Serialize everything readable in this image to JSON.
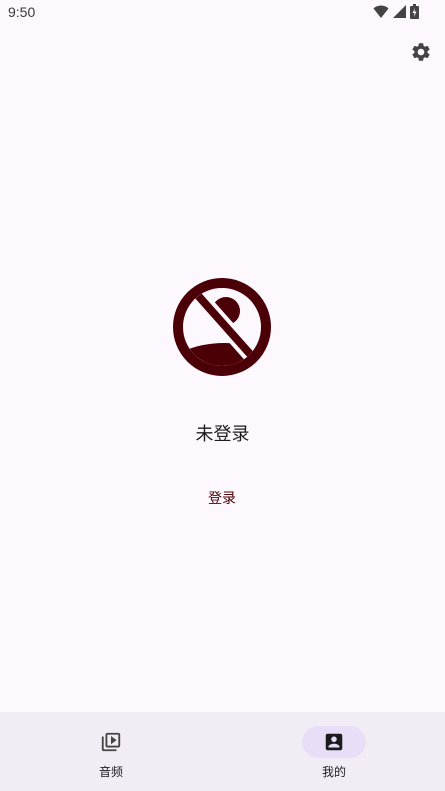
{
  "status_bar": {
    "time": "9:50"
  },
  "toolbar": {
    "settings_icon": "gear-icon"
  },
  "profile": {
    "avatar_icon": "no-avatar-icon",
    "username": "未登录",
    "login_label": "登录"
  },
  "bottom_nav": {
    "items": [
      {
        "label": "音频",
        "icon": "video-library-icon",
        "active": false
      },
      {
        "label": "我的",
        "icon": "account-box-icon",
        "active": true
      }
    ]
  },
  "colors": {
    "background": "#fdf8fd",
    "accent": "#4a0006",
    "nav_background": "#f2edf4",
    "active_pill": "#e8def8"
  }
}
